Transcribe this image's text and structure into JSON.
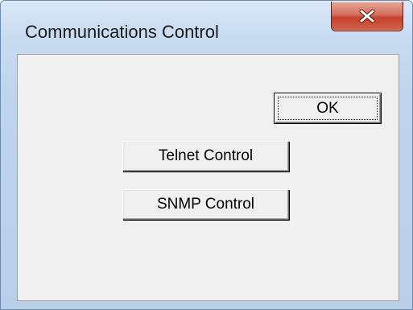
{
  "window": {
    "title": "Communications Control",
    "close_icon": "close-icon",
    "colors": {
      "frame": "#c9dcf1",
      "close_button": "#c5412b",
      "client": "#f0f0f0"
    }
  },
  "buttons": {
    "ok_label": "OK",
    "telnet_label": "Telnet Control",
    "snmp_label": "SNMP Control"
  }
}
